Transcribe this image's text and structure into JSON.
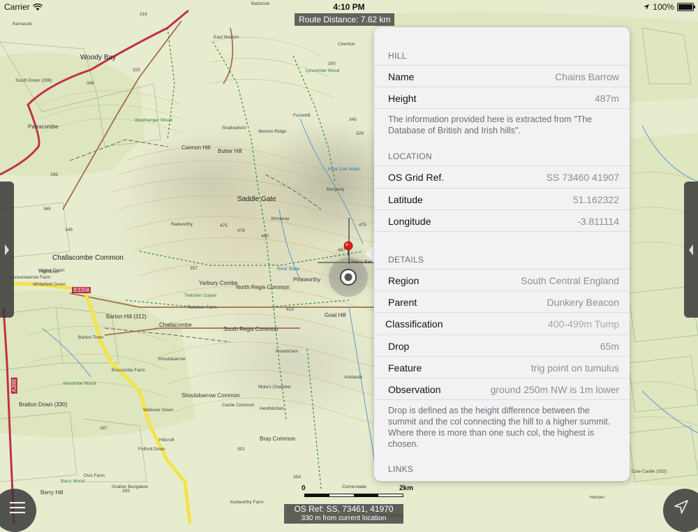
{
  "status_bar": {
    "carrier": "Carrier",
    "time": "4:10 PM",
    "battery": "100%"
  },
  "route_distance": "Route Distance: 7.62 km",
  "map": {
    "place_labels": [
      {
        "text": "Woody Bay",
        "cls": "big"
      },
      {
        "text": "Parracombe",
        "cls": "med"
      },
      {
        "text": "Challacombe Common",
        "cls": "big"
      },
      {
        "text": "Saddle Gate",
        "cls": "big"
      },
      {
        "text": "Cannon Hill",
        "cls": "med"
      },
      {
        "text": "Butter Hill",
        "cls": "med"
      },
      {
        "text": "North Regis Common",
        "cls": "med"
      },
      {
        "text": "South Regis Common",
        "cls": "med"
      },
      {
        "text": "Barton Hill (312)",
        "cls": "med"
      },
      {
        "text": "Challacombe",
        "cls": "med"
      },
      {
        "text": "Goat Hill",
        "cls": "med"
      },
      {
        "text": "Shoulsbarrow Common",
        "cls": "med"
      },
      {
        "text": "Bratton Down (330)",
        "cls": "med"
      },
      {
        "text": "Bray Common",
        "cls": "med"
      },
      {
        "text": "Berry Hill",
        "cls": "med"
      },
      {
        "text": "Yarbury Combe",
        "cls": "med"
      },
      {
        "text": "Pinkworthy",
        "cls": "med"
      },
      {
        "text": "Winaway",
        "cls": "small"
      },
      {
        "text": "Benjamy",
        "cls": "small"
      },
      {
        "text": "Furzehill",
        "cls": "small"
      },
      {
        "text": "Ilkerton Ridge",
        "cls": "small"
      },
      {
        "text": "Shallowford",
        "cls": "small"
      },
      {
        "text": "Cheriton",
        "cls": "small"
      },
      {
        "text": "Barbrook",
        "cls": "small"
      },
      {
        "text": "South Down (288)",
        "cls": "small"
      },
      {
        "text": "Highdown",
        "cls": "small"
      },
      {
        "text": "Kemacott",
        "cls": "small"
      },
      {
        "text": "East Ilkerton",
        "cls": "small"
      },
      {
        "text": "Henthitchen",
        "cls": "small"
      },
      {
        "text": "Comerslade",
        "cls": "small"
      },
      {
        "text": "Horsen",
        "cls": "small"
      },
      {
        "text": "Cow Castle (332)",
        "cls": "small"
      },
      {
        "text": "Setta Barrow",
        "cls": "small"
      },
      {
        "text": "Chains Barrow",
        "cls": "small"
      },
      {
        "text": "Radworthy",
        "cls": "small"
      },
      {
        "text": "Wallover Down",
        "cls": "small"
      },
      {
        "text": "Shoulsbarrow",
        "cls": "small"
      },
      {
        "text": "Barton Town",
        "cls": "small"
      },
      {
        "text": "Whitefield Down",
        "cls": "small"
      },
      {
        "text": "Higher Down",
        "cls": "small"
      },
      {
        "text": "Stockenbarrow Farm",
        "cls": "small"
      },
      {
        "text": "Buscombe Farm",
        "cls": "small"
      },
      {
        "text": "Fulford Down",
        "cls": "small"
      },
      {
        "text": "Hillcroft",
        "cls": "small"
      },
      {
        "text": "Ovis Farm",
        "cls": "small"
      },
      {
        "text": "Gratton Bungalow",
        "cls": "small"
      },
      {
        "text": "Kedworthy Farm",
        "cls": "small"
      },
      {
        "text": "Castle Common",
        "cls": "small"
      },
      {
        "text": "Mole's Chamber",
        "cls": "small"
      },
      {
        "text": "Acklands",
        "cls": "small"
      },
      {
        "text": "Rowdichen",
        "cls": "small"
      },
      {
        "text": "Hoar Oak Water",
        "cls": "water"
      },
      {
        "text": "River Barle",
        "cls": "water"
      },
      {
        "text": "Lyncombe Wood",
        "cls": "green"
      },
      {
        "text": "Woolhanger Wood",
        "cls": "green"
      },
      {
        "text": "Twitchen Copse",
        "cls": "green"
      },
      {
        "text": "Alscombe Wood",
        "cls": "green"
      },
      {
        "text": "Barry Wood",
        "cls": "green"
      },
      {
        "text": "Twitchen Farm",
        "cls": "small"
      }
    ],
    "spot_heights": [
      "316",
      "325",
      "346",
      "475",
      "478",
      "480",
      "357",
      "475",
      "487",
      "413",
      "365",
      "349",
      "296",
      "287",
      "305",
      "302",
      "354",
      "345",
      "329",
      "300"
    ],
    "road_label": "B3358",
    "road_label_2": "A399",
    "marker": "pin-marker"
  },
  "info_panel": {
    "hill_header": "HILL",
    "name_label": "Name",
    "name_value": "Chains Barrow",
    "height_label": "Height",
    "height_value": "487m",
    "source_note": "The information provided here is extracted from \"The Database of British and Irish hills\".",
    "location_header": "LOCATION",
    "grid_label": "OS Grid Ref.",
    "grid_value": "SS 73460 41907",
    "lat_label": "Latitude",
    "lat_value": "51.162322",
    "lon_label": "Longitude",
    "lon_value": "-3.811114",
    "details_header": "DETAILS",
    "region_label": "Region",
    "region_value": "South Central England",
    "parent_label": "Parent",
    "parent_value": "Dunkery Beacon",
    "class_label": "Classification",
    "class_value": "400-499m Tump",
    "drop_label": "Drop",
    "drop_value": "65m",
    "feature_label": "Feature",
    "feature_value": "trig point on tumulus",
    "obs_label": "Observation",
    "obs_value": "ground 250m NW is 1m lower",
    "drop_note": "Drop is defined as the height difference between the summit and the col connecting the hill to a higher summit. Where there is more than one such col, the highest is chosen.",
    "links_header": "LINKS"
  },
  "scale_bar": {
    "start": "0",
    "end": "2km"
  },
  "os_ref": {
    "line1": "OS Ref: SS, 73461, 41970",
    "line2": "330 m from current location"
  },
  "colors": {
    "map_bg": "#e8eccf",
    "panel_bg": "#f2f2f4",
    "road_red": "#c0304a",
    "road_yellow": "#f2e44a",
    "water_blue": "#2a78c0",
    "marker_red": "#e11e1e"
  },
  "icons": {
    "wifi": "wifi-icon",
    "location": "location-arrow-icon",
    "menu": "menu-icon",
    "locate": "navigation-arrow-icon",
    "left_handle": "chevron-right-icon",
    "right_handle": "chevron-left-icon"
  }
}
